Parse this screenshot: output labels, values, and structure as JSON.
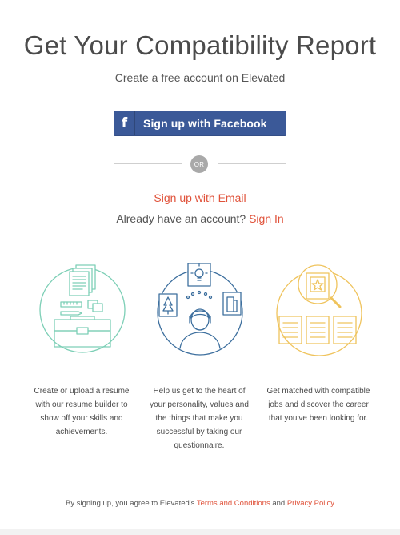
{
  "header": {
    "title": "Get Your Compatibility Report",
    "subtitle": "Create a free account on Elevated"
  },
  "facebook": {
    "icon_glyph": "f",
    "label": "Sign up with Facebook",
    "color": "#3b5998"
  },
  "divider": {
    "label": "OR"
  },
  "email_signup": {
    "label": "Sign up with Email"
  },
  "signin": {
    "prompt": "Already have an account?",
    "link": "Sign In"
  },
  "features": [
    {
      "icon": "resume-toolbox-icon",
      "color": "#7dcfb6",
      "text": "Create or upload a resume with our resume builder to show off your skills and achievements."
    },
    {
      "icon": "personality-head-icon",
      "color": "#3d6f9e",
      "text": "Help us get to the heart of your personality, values and the things that make you successful by taking our questionnaire."
    },
    {
      "icon": "job-search-icon",
      "color": "#efc35c",
      "text": "Get matched with compatible jobs and discover the career that you've been looking for."
    }
  ],
  "footer": {
    "prefix": "By signing up, you agree to Elevated's",
    "terms": "Terms and Conditions",
    "and": "and",
    "privacy": "Privacy Policy"
  },
  "colors": {
    "accent": "#e0523a",
    "divider": "#cfcfcf",
    "or_badge": "#a9a9a9"
  }
}
